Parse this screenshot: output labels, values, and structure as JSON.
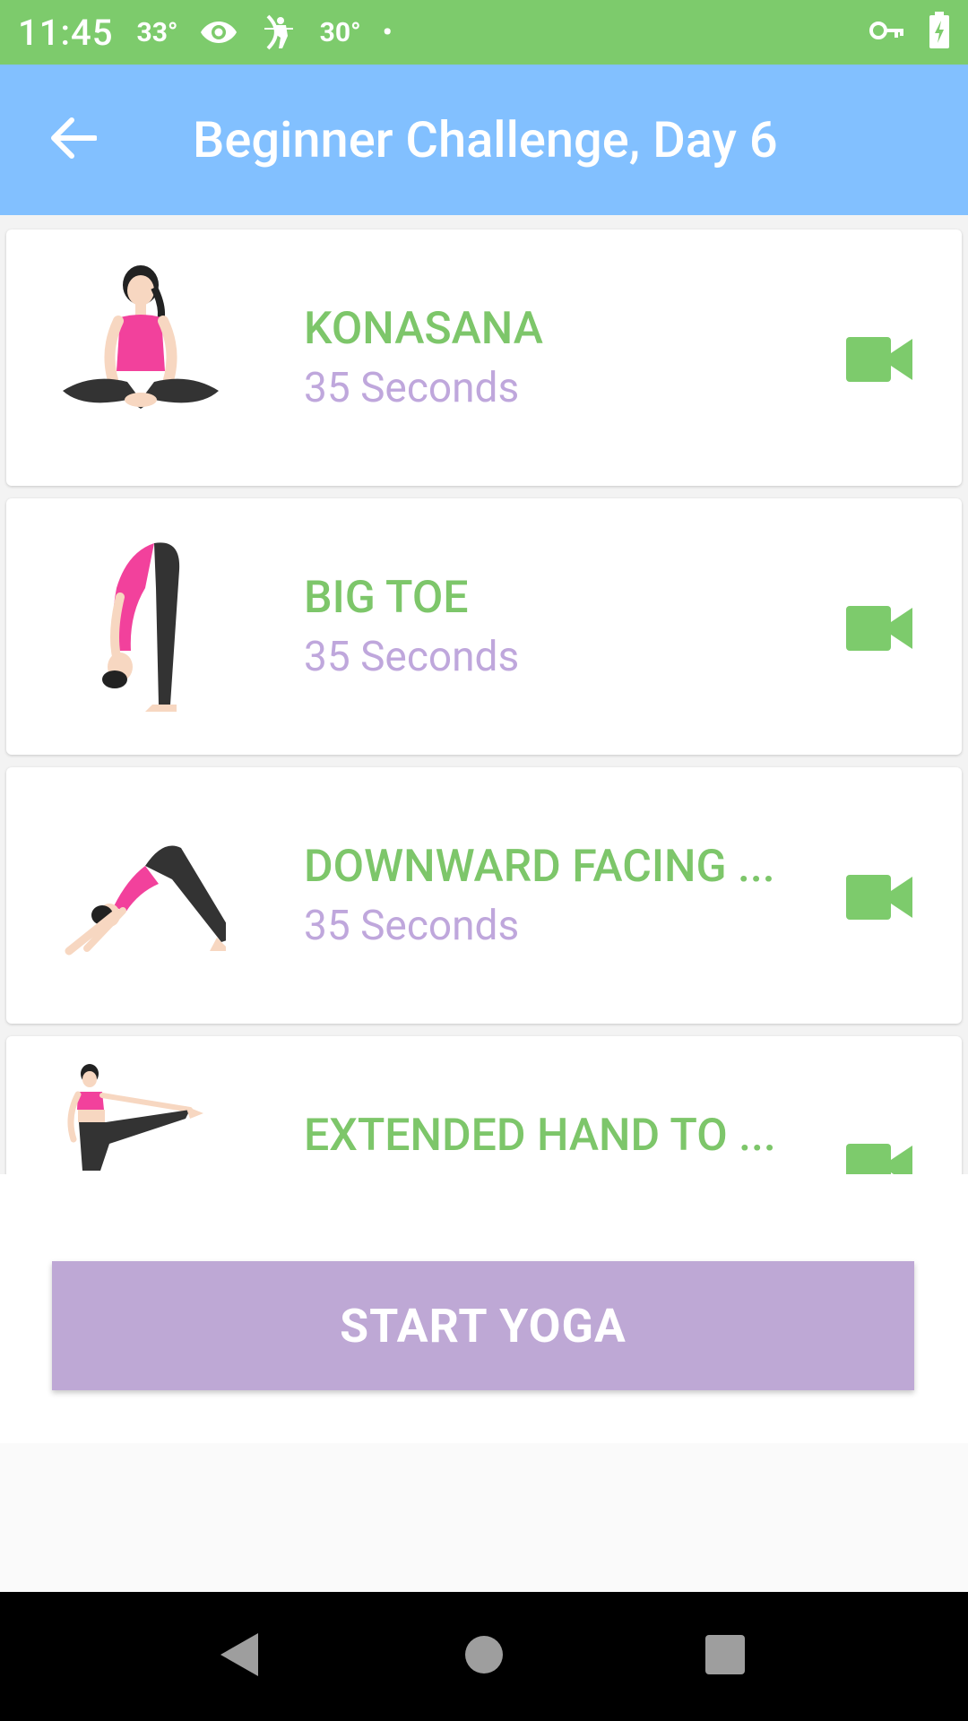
{
  "status_bar": {
    "time": "11:45",
    "temp1": "33°",
    "temp2": "30°",
    "dot": "•"
  },
  "app_bar": {
    "title": "Beginner Challenge, Day 6"
  },
  "exercises": [
    {
      "name": "KONASANA",
      "duration": "35 Seconds",
      "image": "konasana-pose-illustration"
    },
    {
      "name": "BIG TOE",
      "duration": "35 Seconds",
      "image": "big-toe-pose-illustration"
    },
    {
      "name": "DOWNWARD FACING ...",
      "duration": "35 Seconds",
      "image": "downward-dog-pose-illustration"
    },
    {
      "name": "EXTENDED HAND TO ...",
      "duration": "",
      "image": "extended-hand-to-toe-pose-illustration"
    }
  ],
  "start_button": {
    "label": "START YOGA"
  },
  "colors": {
    "status_bar": "#7DCB6C",
    "app_bar": "#82C0FF",
    "exercise_name": "#7DC66A",
    "duration": "#BFA7DC",
    "start_button": "#BEA8D5",
    "video_icon": "#7DCB6C"
  },
  "icons": {
    "back": "arrow-left-icon",
    "video": "video-camera-icon",
    "eye": "eye-icon",
    "key": "vpn-key-icon",
    "battery": "battery-charging-icon"
  }
}
